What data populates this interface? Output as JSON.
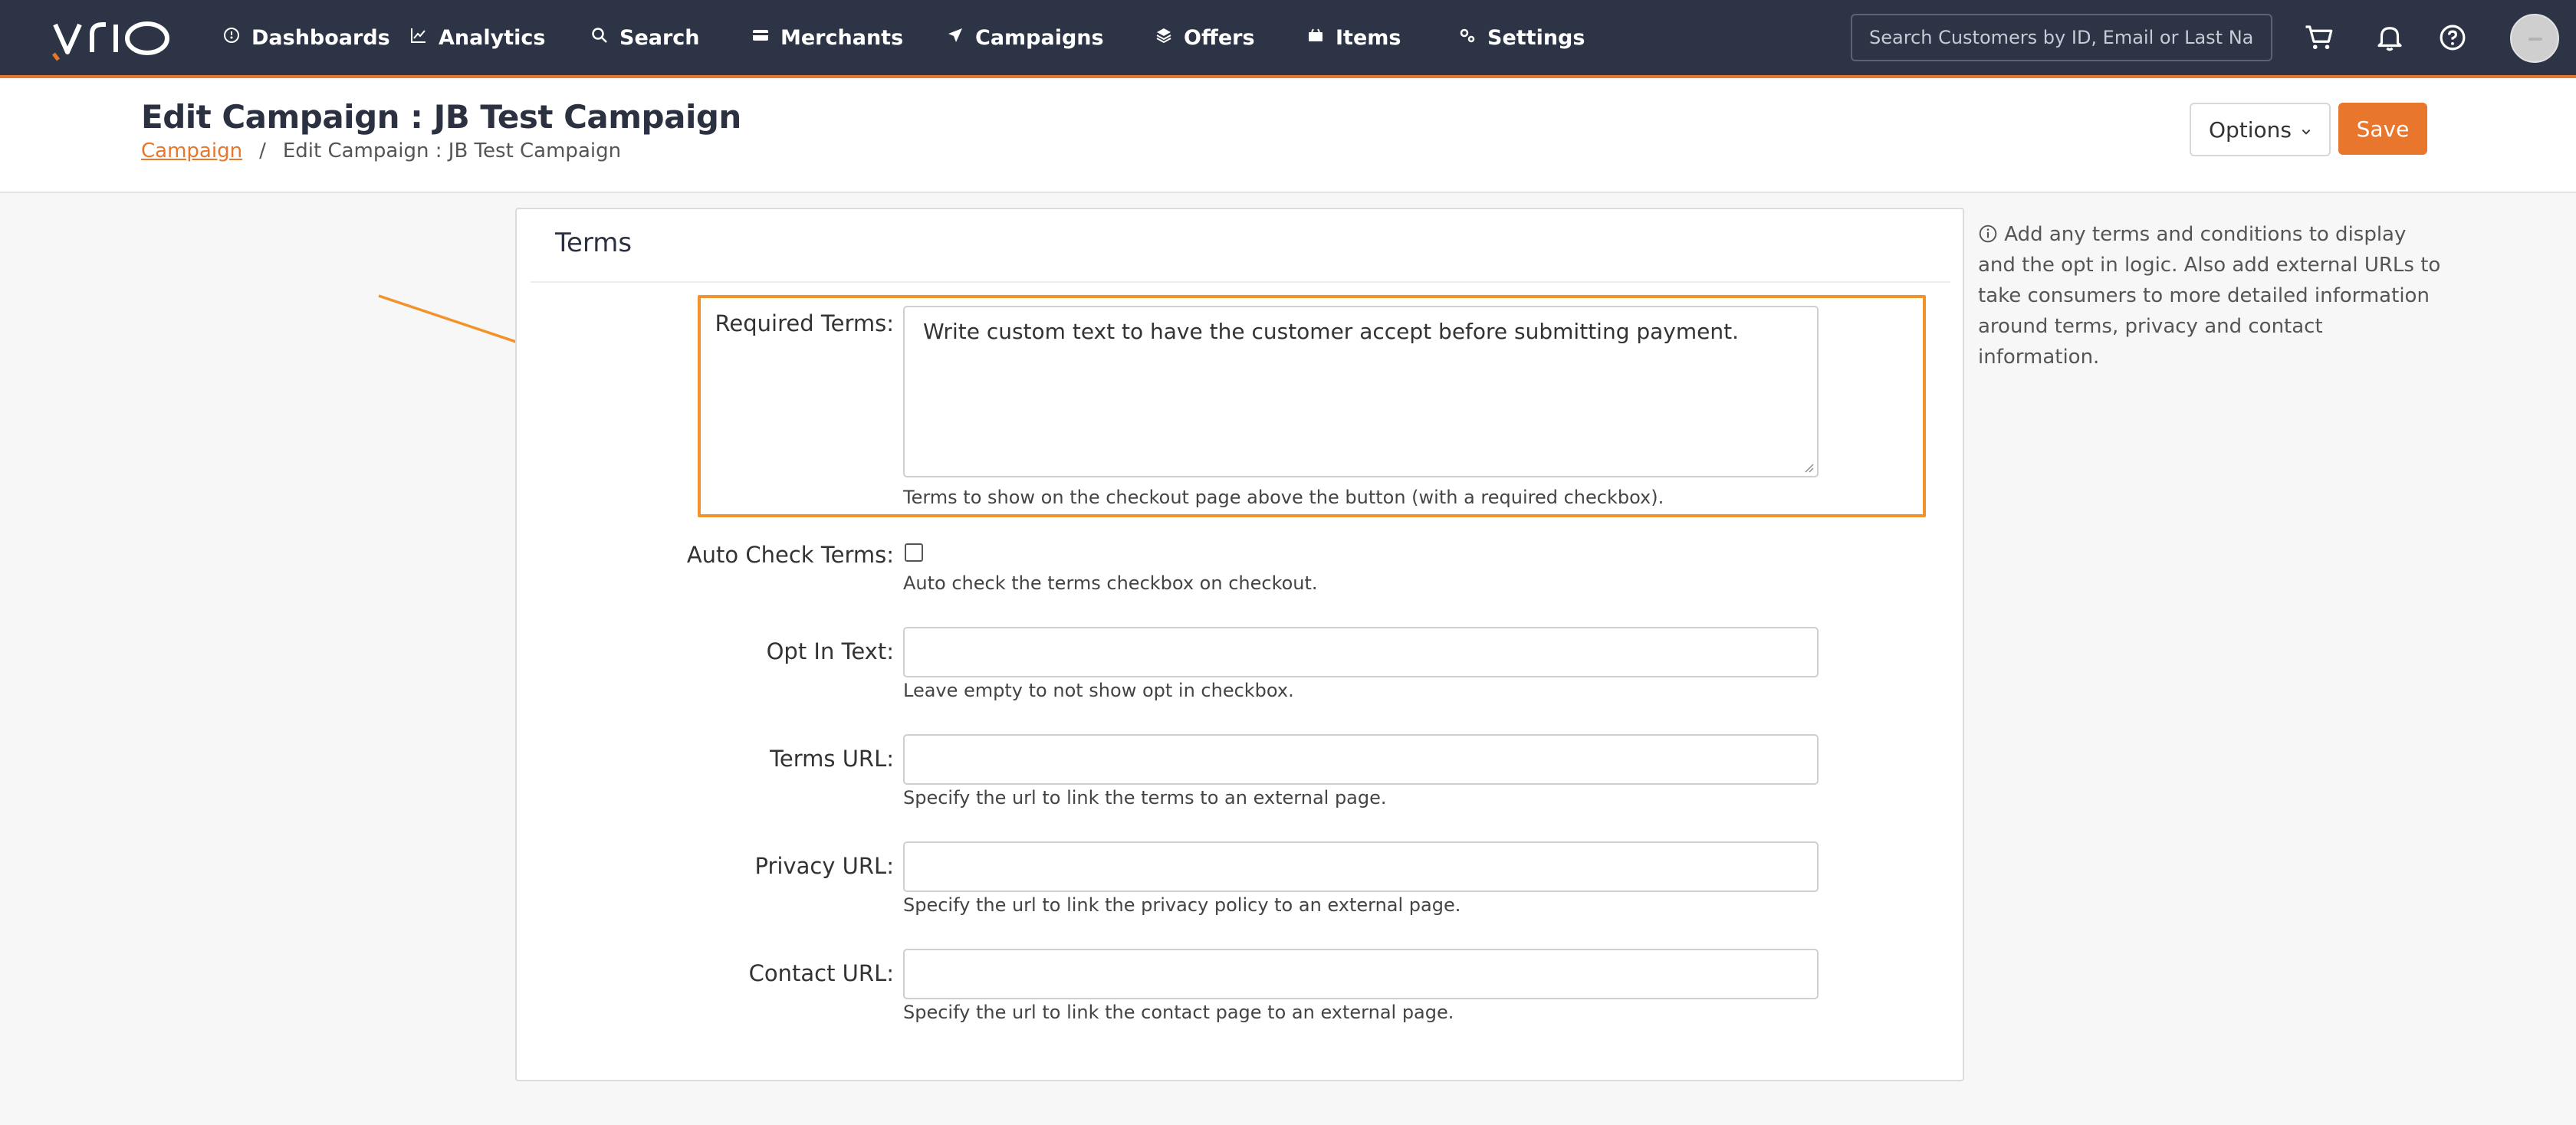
{
  "nav": {
    "logo_text": "vrio",
    "items": [
      {
        "label": "Dashboards",
        "icon": "dashboard-icon"
      },
      {
        "label": "Analytics",
        "icon": "chart-line-icon"
      },
      {
        "label": "Search",
        "icon": "search-icon"
      },
      {
        "label": "Merchants",
        "icon": "card-icon"
      },
      {
        "label": "Campaigns",
        "icon": "send-icon",
        "active": true
      },
      {
        "label": "Offers",
        "icon": "layers-icon"
      },
      {
        "label": "Items",
        "icon": "box-icon"
      },
      {
        "label": "Settings",
        "icon": "gears-icon"
      }
    ],
    "search_placeholder": "Search Customers by ID, Email or Last Name",
    "icons": [
      "cart-icon",
      "bell-icon",
      "help-icon",
      "avatar"
    ]
  },
  "header": {
    "title": "Edit Campaign : JB Test Campaign",
    "breadcrumb": {
      "link": "Campaign",
      "separator": "/",
      "current": "Edit Campaign : JB Test Campaign"
    },
    "options_label": "Options",
    "save_label": "Save"
  },
  "card": {
    "title": "Terms",
    "fields": {
      "required_terms": {
        "label": "Required Terms:",
        "value": "Write custom text to have the customer accept before submitting payment.",
        "help": "Terms to show on the checkout page above the button (with a required checkbox)."
      },
      "auto_check": {
        "label": "Auto Check Terms:",
        "help": "Auto check the terms checkbox on checkout.",
        "checked": false
      },
      "opt_in": {
        "label": "Opt In Text:",
        "value": "",
        "help": "Leave empty to not show opt in checkbox."
      },
      "terms_url": {
        "label": "Terms URL:",
        "value": "",
        "help": "Specify the url to link the terms to an external page."
      },
      "privacy_url": {
        "label": "Privacy URL:",
        "value": "",
        "help": "Specify the url to link the privacy policy to an external page."
      },
      "contact_url": {
        "label": "Contact URL:",
        "value": "",
        "help": "Specify the url to link the contact page to an external page."
      }
    }
  },
  "side_note": "Add any terms and conditions to display and the opt in logic. Also add external URLs to take consumers to more detailed information around terms, privacy and contact information.",
  "colors": {
    "nav_bg": "#2d3446",
    "accent": "#e8762d",
    "highlight": "#f2922a"
  }
}
